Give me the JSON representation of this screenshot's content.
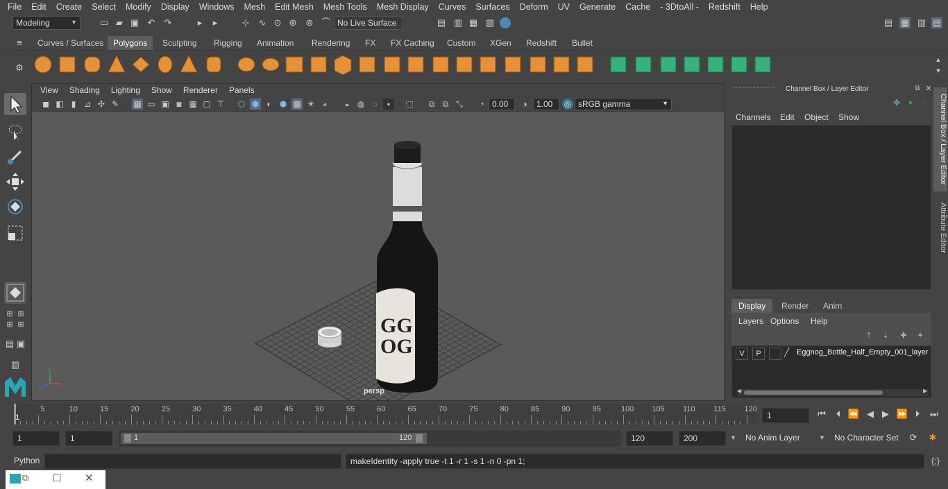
{
  "menubar": {
    "items": [
      "File",
      "Edit",
      "Create",
      "Select",
      "Modify",
      "Display",
      "Windows",
      "Mesh",
      "Edit Mesh",
      "Mesh Tools",
      "Mesh Display",
      "Curves",
      "Surfaces",
      "Deform",
      "UV",
      "Generate",
      "Cache",
      "- 3DtoAll -",
      "Redshift",
      "Help"
    ]
  },
  "status": {
    "mode": "Modeling",
    "live_surface": "No Live Surface"
  },
  "shelf": {
    "tabs": [
      "Curves / Surfaces",
      "Polygons",
      "Sculpting",
      "Rigging",
      "Animation",
      "Rendering",
      "FX",
      "FX Caching",
      "Custom",
      "XGen",
      "Redshift",
      "Bullet"
    ],
    "active_tab": "Polygons"
  },
  "viewport": {
    "menus": [
      "View",
      "Shading",
      "Lighting",
      "Show",
      "Renderer",
      "Panels"
    ],
    "exposure": "0.00",
    "gamma": "1.00",
    "color_space": "sRGB gamma",
    "camera_label": "persp",
    "label_text": "GG\nOG"
  },
  "channel_box": {
    "title": "Channel Box / Layer Editor",
    "menus": [
      "Channels",
      "Edit",
      "Object",
      "Show"
    ]
  },
  "layer_editor": {
    "tabs": [
      "Display",
      "Render",
      "Anim"
    ],
    "active_tab": "Display",
    "menus": [
      "Layers",
      "Options",
      "Help"
    ],
    "layer": {
      "v": "V",
      "p": "P",
      "name": "Eggnog_Bottle_Half_Empty_001_layer"
    }
  },
  "side_tabs": {
    "channel_box": "Channel Box / Layer Editor",
    "attribute_editor": "Attribute Editor"
  },
  "timeline": {
    "ticks": [
      5,
      10,
      15,
      20,
      25,
      30,
      35,
      40,
      45,
      50,
      55,
      60,
      65,
      70,
      75,
      80,
      85,
      90,
      95,
      100,
      105,
      110,
      115,
      120
    ],
    "start_marker": "1",
    "current_frame": "1"
  },
  "range": {
    "start": "1",
    "playback_start": "1",
    "slider_start": "1",
    "slider_end": "120",
    "playback_end": "120",
    "end": "200",
    "anim_layer": "No Anim Layer",
    "character_set": "No Character Set"
  },
  "cmdline": {
    "lang": "Python",
    "input": "",
    "output": "makeIdentity -apply true -t 1 -r 1 -s 1 -n 0 -pn 1;"
  },
  "colors": {
    "accent_blue": "#4a8ab5",
    "shelf_orange": "#e5913a",
    "shelf_green": "#38b27a"
  }
}
